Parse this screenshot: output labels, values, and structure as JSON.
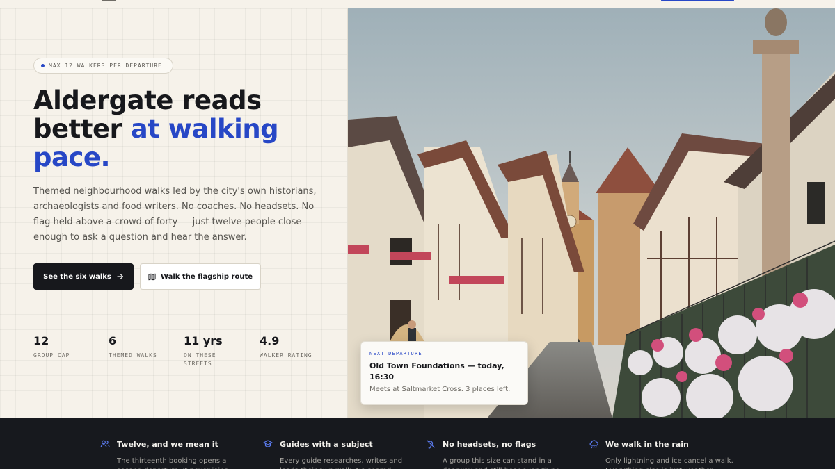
{
  "hero": {
    "pill_label": "MAX 12 WALKERS PER DEPARTURE",
    "headline_part1": "Aldergate reads better ",
    "headline_accent": "at walking pace.",
    "lede": "Themed neighbourhood walks led by the city's own historians, archaeologists and food writers. No coaches. No headsets. No flag held above a crowd of forty — just twelve people close enough to ask a question and hear the answer.",
    "primary_button": "See the six walks",
    "secondary_button": "Walk the flagship route"
  },
  "stats": [
    {
      "value": "12",
      "label": "GROUP CAP"
    },
    {
      "value": "6",
      "label": "THEMED WALKS"
    },
    {
      "value": "11 yrs",
      "label": "ON THESE STREETS"
    },
    {
      "value": "4.9",
      "label": "WALKER RATING"
    }
  ],
  "next_departure": {
    "tag": "NEXT DEPARTURE",
    "title": "Old Town Foundations — today, 16:30",
    "meta": "Meets at Saltmarket Cross. 3 places left."
  },
  "features": [
    {
      "title": "Twelve, and we mean it",
      "body": "The thirteenth booking opens a second departure. It never joins yours.",
      "icon": "users-icon"
    },
    {
      "title": "Guides with a subject",
      "body": "Every guide researches, writes and leads their own walk. No shared script.",
      "icon": "graduation-cap-icon"
    },
    {
      "title": "No headsets, no flags",
      "body": "A group this size can stand in a doorway and still hear everything.",
      "icon": "headset-off-icon"
    },
    {
      "title": "We walk in the rain",
      "body": "Only lightning and ice cancel a walk. Everything else is just weather.",
      "icon": "cloud-rain-icon"
    }
  ],
  "colors": {
    "accent": "#2747c6",
    "dark": "#17191e",
    "paper": "#f6f2ea"
  }
}
